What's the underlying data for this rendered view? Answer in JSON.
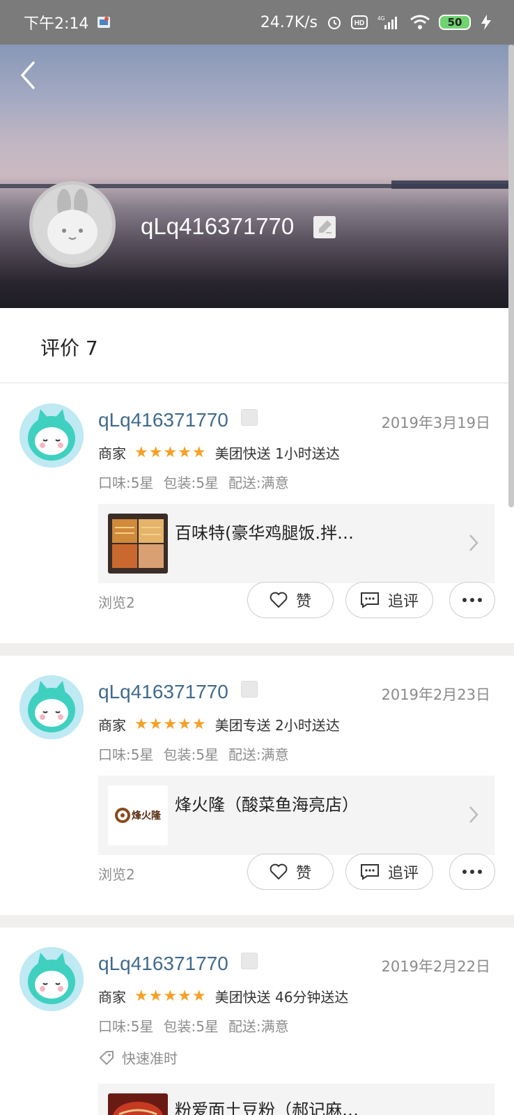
{
  "status_bar": {
    "time": "下午2:14",
    "speed": "24.7K/s",
    "battery": "50"
  },
  "profile": {
    "username": "qLq416371770"
  },
  "section": {
    "title": "评价 7"
  },
  "reviews": [
    {
      "username": "qLq416371770",
      "date": "2019年3月19日",
      "merchant_label": "商家",
      "stars": "★★★★★",
      "delivery": "美团快送 1小时送达",
      "score_taste": "口味:5星",
      "score_pack": "包装:5星",
      "score_delivery": "配送:满意",
      "shop_name": "百味特(豪华鸡腿饭.拌…",
      "views": "浏览2",
      "like_label": "赞",
      "followup_label": "追评"
    },
    {
      "username": "qLq416371770",
      "date": "2019年2月23日",
      "merchant_label": "商家",
      "stars": "★★★★★",
      "delivery": "美团专送 2小时送达",
      "score_taste": "口味:5星",
      "score_pack": "包装:5星",
      "score_delivery": "配送:满意",
      "shop_name": "烽火隆（酸菜鱼海亮店）",
      "shop_logo_text": "烽火隆",
      "views": "浏览2",
      "like_label": "赞",
      "followup_label": "追评"
    },
    {
      "username": "qLq416371770",
      "date": "2019年2月22日",
      "merchant_label": "商家",
      "stars": "★★★★★",
      "delivery": "美团快送 46分钟送达",
      "score_taste": "口味:5星",
      "score_pack": "包装:5星",
      "score_delivery": "配送:满意",
      "tag": "快速准时",
      "shop_name": "粉爱面土豆粉（郝记麻…"
    }
  ],
  "colors": {
    "username_blue": "#406a8e",
    "star_orange": "#f6a024"
  }
}
